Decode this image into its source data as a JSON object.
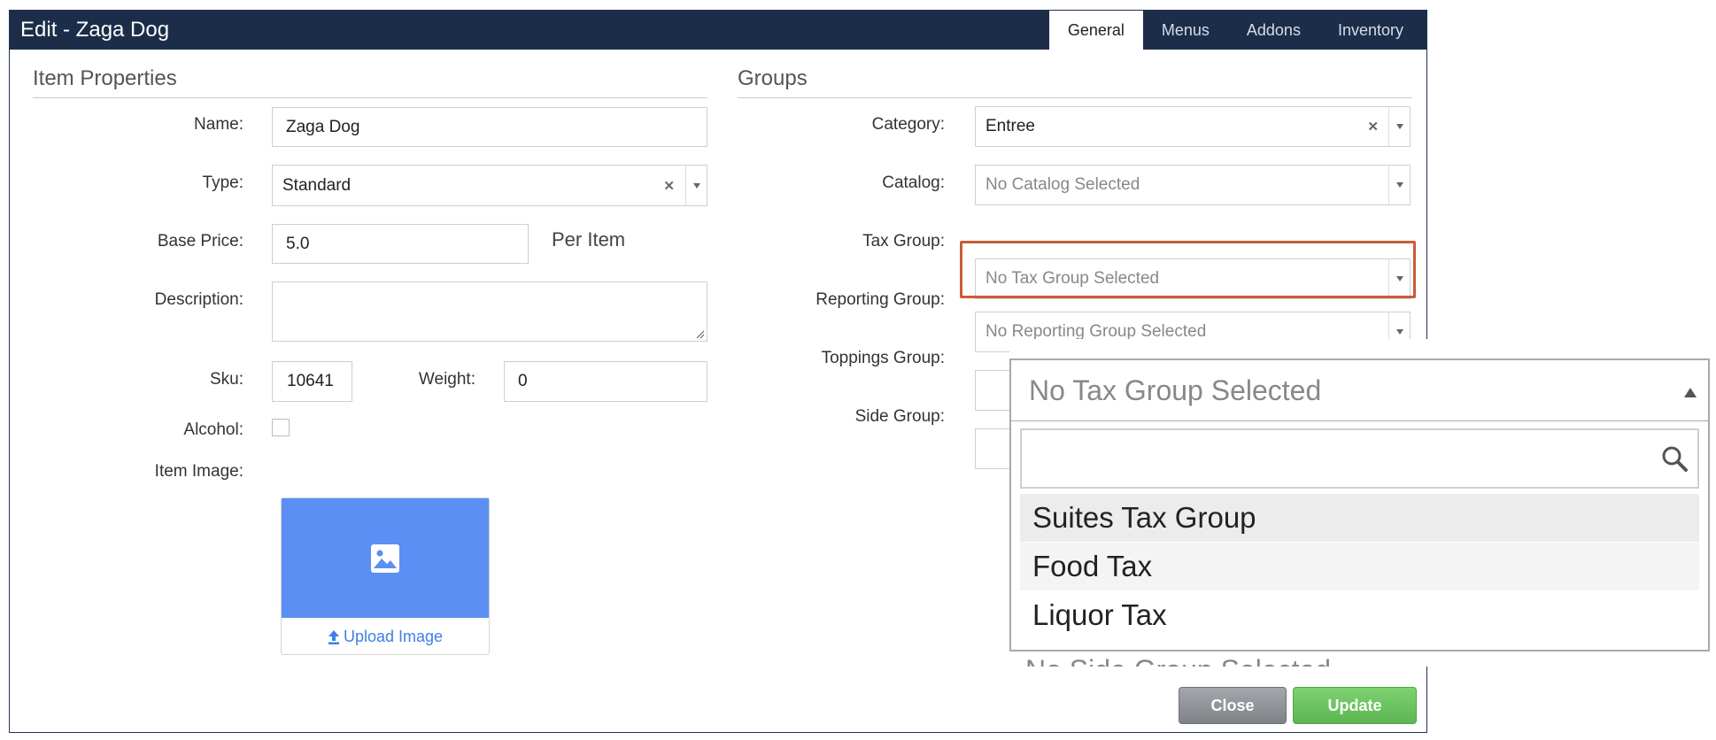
{
  "window": {
    "title": "Edit - Zaga Dog"
  },
  "tabs": [
    {
      "label": "General",
      "active": true
    },
    {
      "label": "Menus",
      "active": false
    },
    {
      "label": "Addons",
      "active": false
    },
    {
      "label": "Inventory",
      "active": false
    }
  ],
  "item_properties": {
    "title": "Item Properties",
    "name_label": "Name:",
    "name_value": "Zaga Dog",
    "type_label": "Type:",
    "type_value": "Standard",
    "base_price_label": "Base Price:",
    "base_price_value": "5.0",
    "per_item": "Per Item",
    "description_label": "Description:",
    "description_value": "",
    "sku_label": "Sku:",
    "sku_value": "10641",
    "weight_label": "Weight:",
    "weight_value": "0",
    "alcohol_label": "Alcohol:",
    "alcohol_checked": false,
    "item_image_label": "Item Image:",
    "upload_label": "Upload Image"
  },
  "groups": {
    "title": "Groups",
    "category_label": "Category:",
    "category_value": "Entree",
    "catalog_label": "Catalog:",
    "catalog_placeholder": "No Catalog Selected",
    "tax_group_label": "Tax Group:",
    "tax_group_placeholder": "No Tax Group Selected",
    "reporting_group_label": "Reporting Group:",
    "reporting_group_placeholder": "No Reporting Group Selected",
    "toppings_group_label": "Toppings Group:",
    "side_group_label": "Side Group:"
  },
  "buttons": {
    "close": "Close",
    "update": "Update"
  },
  "tax_dropdown_zoom": {
    "placeholder": "No Tax Group Selected",
    "search_value": "",
    "options": [
      "Suites Tax Group",
      "Food Tax",
      "Liquor Tax"
    ],
    "partial_text_below": "No Side Group Selected"
  },
  "colors": {
    "title_bar": "#1b2d49",
    "highlight_border": "#cc5b34",
    "image_placeholder": "#5b8ff4",
    "update_button": "#5cb552",
    "close_button": "#8a8d91"
  }
}
